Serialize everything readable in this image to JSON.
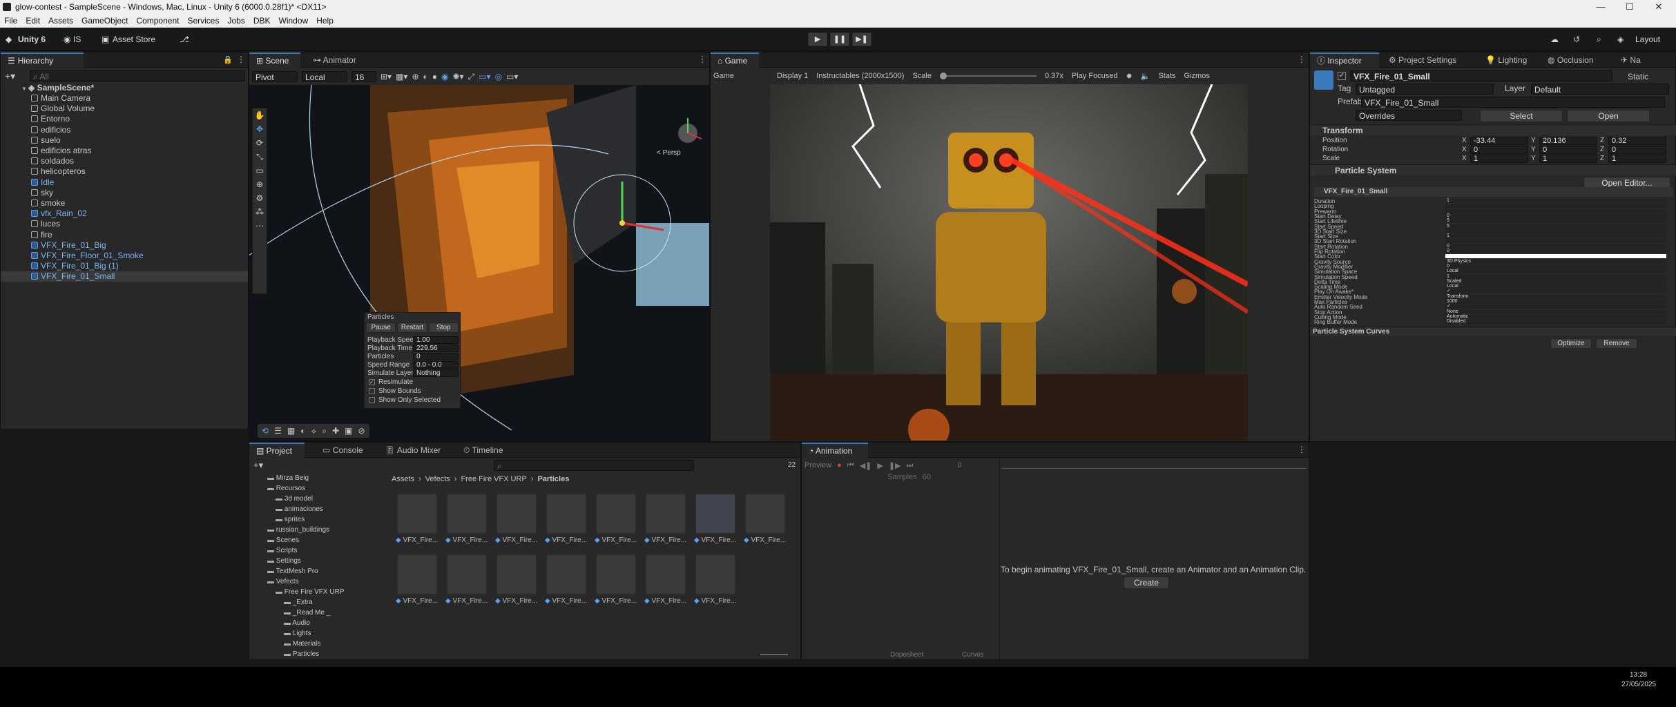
{
  "titlebar": {
    "title": "glow-contest - SampleScene - Windows, Mac, Linux - Unity 6 (6000.0.28f1)* <DX11>",
    "min": "—",
    "max": "☐",
    "close": "✕"
  },
  "menu": [
    "File",
    "Edit",
    "Assets",
    "GameObject",
    "Component",
    "Services",
    "Jobs",
    "DBK",
    "Window",
    "Help"
  ],
  "toolbar": {
    "unity6": "Unity 6",
    "account": "IS",
    "asset_store": "Asset Store",
    "layout": "Layout"
  },
  "hierarchy": {
    "tab": "Hierarchy",
    "search_placeholder": "All",
    "scene": "SampleScene*",
    "items": [
      {
        "label": "Main Camera",
        "blue": false
      },
      {
        "label": "Global Volume",
        "blue": false
      },
      {
        "label": "Entorno",
        "blue": false
      },
      {
        "label": "edificios",
        "blue": false
      },
      {
        "label": "suelo",
        "blue": false
      },
      {
        "label": "edificios atras",
        "blue": false
      },
      {
        "label": "soldados",
        "blue": false
      },
      {
        "label": "helicopteros",
        "blue": false
      },
      {
        "label": "Idle",
        "blue": true
      },
      {
        "label": "sky",
        "blue": false
      },
      {
        "label": "smoke",
        "blue": false
      },
      {
        "label": "vfx_Rain_02",
        "blue": true
      },
      {
        "label": "luces",
        "blue": false
      },
      {
        "label": "fire",
        "blue": false
      },
      {
        "label": "VFX_Fire_01_Big",
        "blue": true
      },
      {
        "label": "VFX_Fire_Floor_01_Smoke",
        "blue": true
      },
      {
        "label": "VFX_Fire_01_Big (1)",
        "blue": true
      },
      {
        "label": "VFX_Fire_01_Small",
        "blue": true
      }
    ]
  },
  "scene": {
    "tabs": [
      "Scene",
      "Animator"
    ],
    "pivot": "Pivot",
    "local": "Local",
    "grid_size": "16",
    "persp": "< Persp",
    "overlay": {
      "title": "Particles",
      "pause": "Pause",
      "restart": "Restart",
      "stop": "Stop",
      "rows": [
        [
          "Playback Speed",
          "1.00"
        ],
        [
          "Playback Time",
          "229.56"
        ],
        [
          "Particles",
          "0"
        ],
        [
          "Speed Range",
          "0.0 - 0.0"
        ],
        [
          "Simulate Layers",
          "Nothing"
        ]
      ],
      "checks": [
        [
          "Resimulate",
          true
        ],
        [
          "Show Bounds",
          false
        ],
        [
          "Show Only Selected",
          false
        ]
      ]
    }
  },
  "game": {
    "tab": "Game",
    "mode": "Game",
    "display": "Display 1",
    "resolution": "Instructables (2000x1500)",
    "scale_label": "Scale",
    "scale_value": "0.37x",
    "play_focused": "Play Focused",
    "stats": "Stats",
    "gizmos": "Gizmos"
  },
  "inspector": {
    "tabs": [
      "Inspector",
      "Project Settings",
      "Lighting",
      "Occlusion",
      "Na"
    ],
    "object_name": "VFX_Fire_01_Small",
    "static": "Static",
    "tag_label": "Tag",
    "tag": "Untagged",
    "layer_label": "Layer",
    "layer": "Default",
    "prefab_label": "Prefab",
    "prefab": "VFX_Fire_01_Small",
    "overrides": "Overrides",
    "select": "Select",
    "open": "Open",
    "transform": {
      "title": "Transform",
      "position": [
        "-33.44",
        "20.136",
        "0.32"
      ],
      "rotation": [
        "0",
        "0",
        "0"
      ],
      "scale": [
        "1",
        "1",
        "1"
      ],
      "labels": [
        "Position",
        "Rotation",
        "Scale"
      ]
    },
    "particle_system": {
      "title": "Particle System",
      "open_editor": "Open Editor...",
      "name": "VFX_Fire_01_Small",
      "rows": [
        [
          "Duration",
          "1"
        ],
        [
          "Looping",
          ""
        ],
        [
          "Prewarm",
          ""
        ],
        [
          "Start Delay",
          "0"
        ],
        [
          "Start Lifetime",
          "5"
        ],
        [
          "Start Speed",
          "5"
        ],
        [
          "3D Start Size",
          ""
        ],
        [
          "Start Size",
          "1"
        ],
        [
          "3D Start Rotation",
          ""
        ],
        [
          "Start Rotation",
          "0"
        ],
        [
          "Flip Rotation",
          "0"
        ],
        [
          "Start Color",
          ""
        ],
        [
          "Gravity Source",
          "3D Physics"
        ],
        [
          "Gravity Modifier",
          "0"
        ],
        [
          "Simulation Space",
          "Local"
        ],
        [
          "Simulation Speed",
          "1"
        ],
        [
          "Delta Time",
          "Scaled"
        ],
        [
          "Scaling Mode",
          "Local"
        ],
        [
          "Play On Awake*",
          "✓"
        ],
        [
          "Emitter Velocity Mode",
          "Transform"
        ],
        [
          "Max Particles",
          "1000"
        ],
        [
          "Auto Random Seed",
          "✓"
        ],
        [
          "Stop Action",
          "None"
        ],
        [
          "Culling Mode",
          "Automatic"
        ],
        [
          "Ring Buffer Mode",
          "Disabled"
        ]
      ]
    },
    "curves": {
      "title": "Particle System Curves",
      "optimize": "Optimize",
      "remove": "Remove"
    }
  },
  "project": {
    "tabs": [
      "Project",
      "Console",
      "Audio Mixer",
      "Timeline"
    ],
    "count": "22",
    "tree": [
      [
        "Mirza Beig",
        1
      ],
      [
        "Recursos",
        1
      ],
      [
        "3d model",
        2
      ],
      [
        "animaciones",
        2
      ],
      [
        "sprites",
        2
      ],
      [
        "russian_buildings",
        1
      ],
      [
        "Scenes",
        1
      ],
      [
        "Scripts",
        1
      ],
      [
        "Settings",
        1
      ],
      [
        "TextMesh Pro",
        1
      ],
      [
        "Vefects",
        1
      ],
      [
        "Free Fire VFX URP",
        2
      ],
      [
        "_Extra",
        3
      ],
      [
        "_Read Me _",
        3
      ],
      [
        "Audio",
        3
      ],
      [
        "Lights",
        3
      ],
      [
        "Materials",
        3
      ],
      [
        "Particles",
        3
      ]
    ],
    "breadcrumb": [
      "Assets",
      "Vefects",
      "Free Fire VFX URP",
      "Particles"
    ],
    "asset_label": "VFX_Fire..."
  },
  "animation": {
    "tab": "Animation",
    "preview": "Preview",
    "samples_label": "Samples",
    "samples": "60",
    "frame": "0",
    "message": "To begin animating VFX_Fire_01_Small, create an Animator and an Animation Clip.",
    "create": "Create",
    "dopesheet": "Dopesheet",
    "curves": "Curves"
  },
  "taskbar": {
    "time": "13:28",
    "date": "27/05/2025"
  }
}
